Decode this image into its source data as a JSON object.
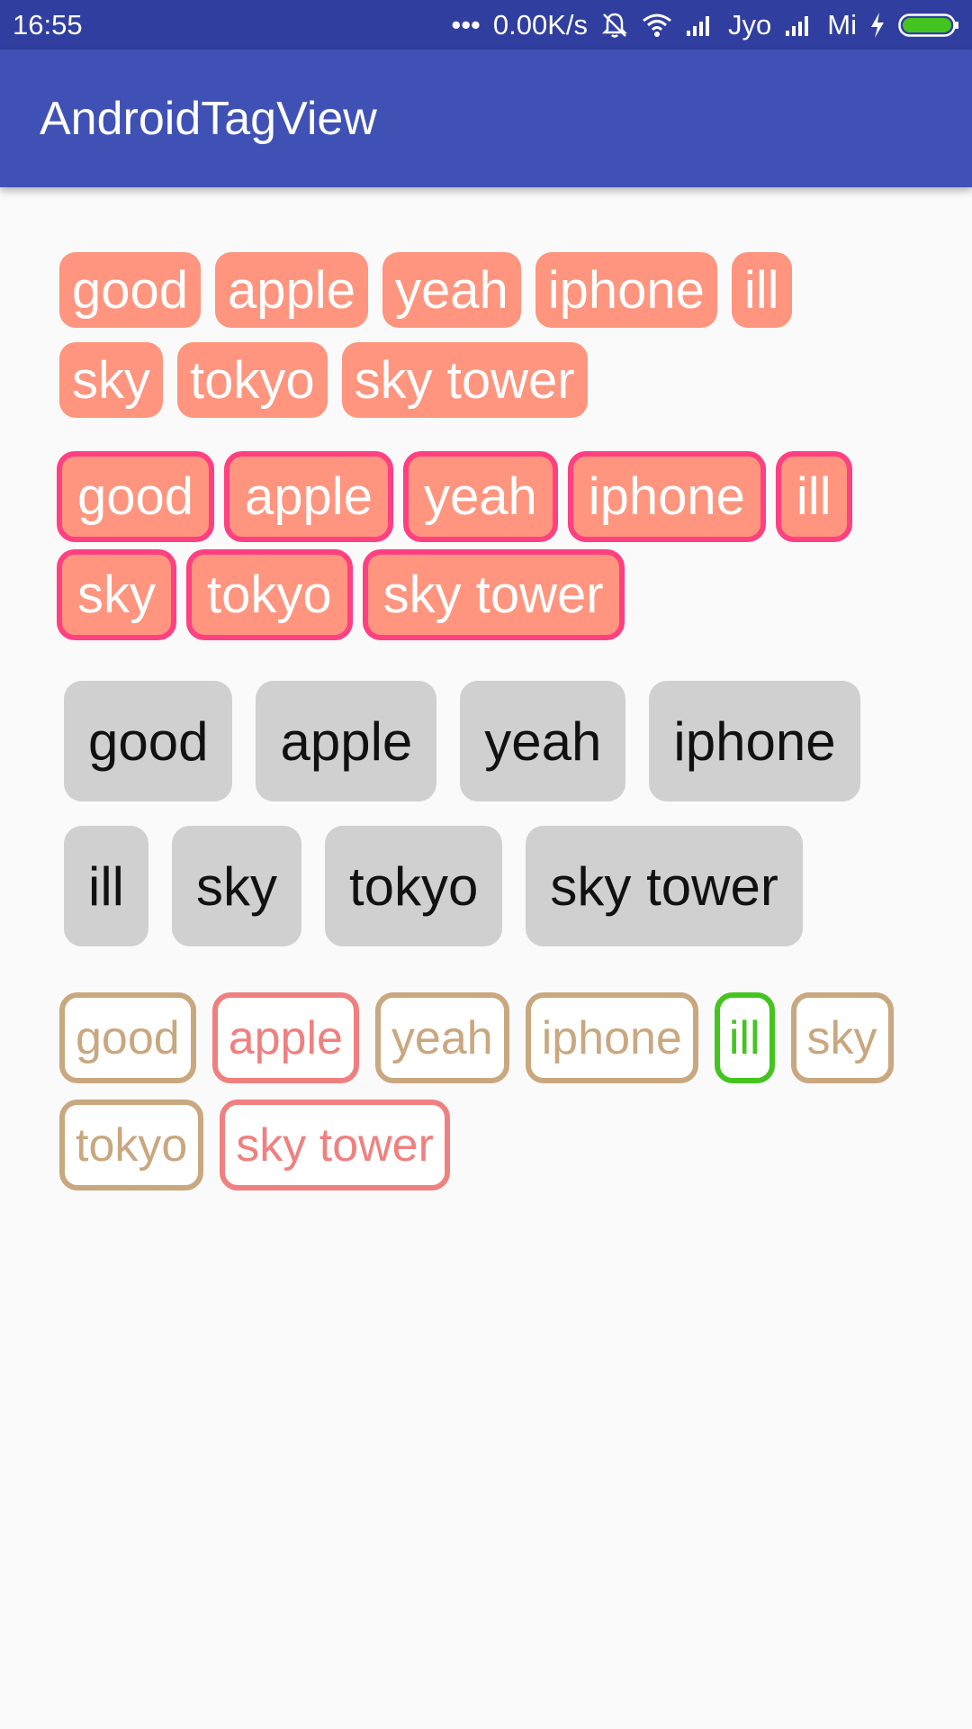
{
  "status_bar": {
    "time": "16:55",
    "dots": "•••",
    "speed": "0.00K/s",
    "carrier1": "Jyo",
    "carrier2": "Mi",
    "icons": [
      "alarm-off-icon",
      "wifi-icon",
      "signal-icon",
      "signal-icon",
      "charging-icon",
      "battery-icon"
    ],
    "battery_color": "#44c41f"
  },
  "app_bar": {
    "title": "AndroidTagView",
    "color": "#3f51b5"
  },
  "groups": [
    {
      "rows": [
        [
          "good",
          "apple",
          "yeah",
          "iphone",
          "ill"
        ],
        [
          "sky",
          "tokyo",
          "sky tower"
        ]
      ]
    },
    {
      "rows": [
        [
          "good",
          "apple",
          "yeah",
          "iphone",
          "ill"
        ],
        [
          "sky",
          "tokyo",
          "sky tower"
        ]
      ]
    },
    {
      "rows": [
        [
          "good",
          "apple",
          "yeah",
          "iphone"
        ],
        [
          "ill",
          "sky",
          "tokyo",
          "sky tower"
        ]
      ]
    },
    {
      "rows": [
        [
          "good",
          "apple",
          "yeah",
          "iphone",
          "ill",
          "sky"
        ],
        [
          "tokyo",
          "sky tower"
        ]
      ],
      "tag_colors": {
        "good": "#c9a77f",
        "apple": "#f08080",
        "yeah": "#c9a77f",
        "iphone": "#c9a77f",
        "ill": "#44c41f",
        "sky": "#c9a77f",
        "tokyo": "#c9a77f",
        "sky tower": "#f08080"
      }
    }
  ]
}
